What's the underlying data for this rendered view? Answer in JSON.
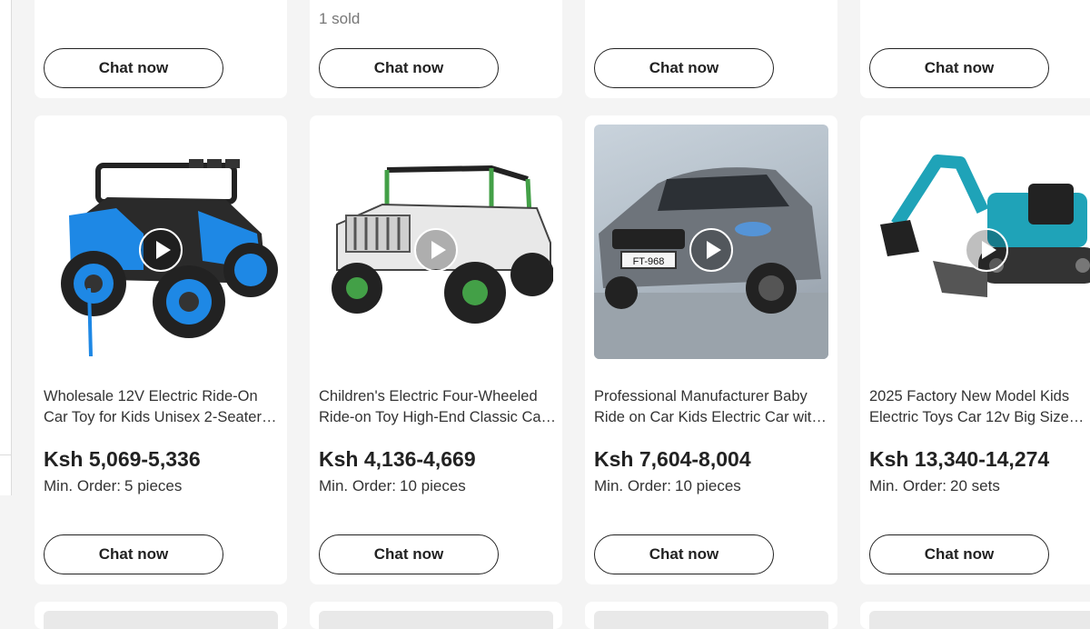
{
  "top_row": [
    {
      "sold": "",
      "chat_label": "Chat now"
    },
    {
      "sold": "1 sold",
      "chat_label": "Chat now"
    },
    {
      "sold": "",
      "chat_label": "Chat now"
    },
    {
      "sold": "",
      "chat_label": "Chat now"
    }
  ],
  "products": [
    {
      "title_line1": "Wholesale 12V Electric Ride-On",
      "title_line2": "Car Toy for Kids Unisex 2-Seater…",
      "price": "Ksh 5,069-5,336",
      "moq_label": "Min. Order:",
      "moq_value": "5 pieces",
      "chat_label": "Chat now",
      "image_icon": "blue-utv-ride-on-car",
      "accent": "#1e88e5"
    },
    {
      "title_line1": "Children's Electric Four-Wheeled",
      "title_line2": "Ride-on Toy High-End Classic Ca…",
      "price": "Ksh 4,136-4,669",
      "moq_label": "Min. Order:",
      "moq_value": "10 pieces",
      "chat_label": "Chat now",
      "image_icon": "white-green-jeep-ride-on",
      "accent": "#43a047"
    },
    {
      "title_line1": "Professional Manufacturer Baby",
      "title_line2": "Ride on Car Kids Electric Car wit…",
      "price": "Ksh 7,604-8,004",
      "moq_label": "Min. Order:",
      "moq_value": "10 pieces",
      "chat_label": "Chat now",
      "image_icon": "grey-suv-ride-on-car",
      "plate": "FT-968",
      "accent": "#7a8088"
    },
    {
      "title_line1": "2025 Factory New Model Kids",
      "title_line2": "Electric Toys Car 12v Big Size…",
      "price": "Ksh 13,340-14,274",
      "moq_label": "Min. Order:",
      "moq_value": "20 sets",
      "chat_label": "Chat now",
      "image_icon": "teal-excavator-ride-on",
      "accent": "#1fa3b8"
    }
  ]
}
